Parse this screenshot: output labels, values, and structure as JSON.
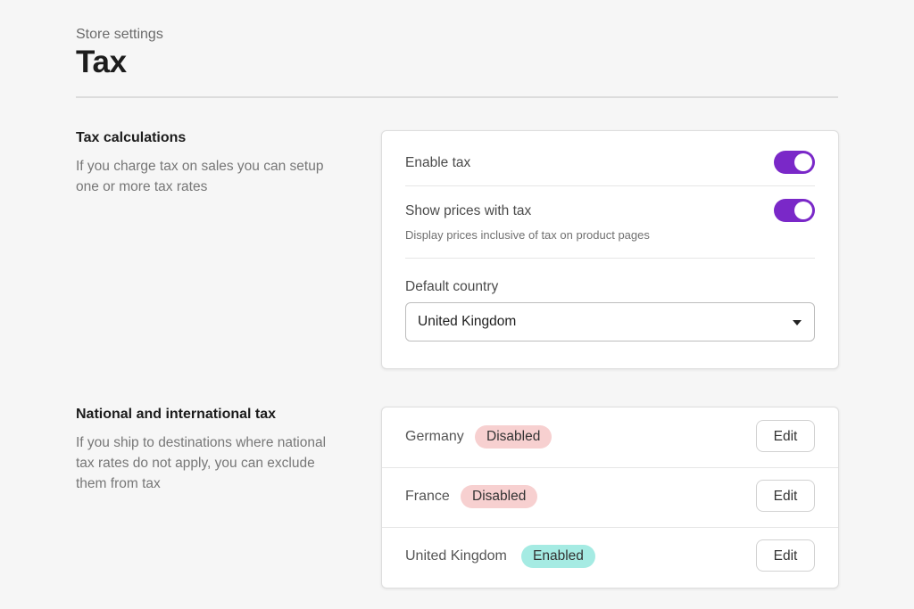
{
  "header": {
    "eyebrow": "Store settings",
    "title": "Tax"
  },
  "tax_calculations": {
    "title": "Tax calculations",
    "description": "If you charge tax on sales you can setup one or more tax rates",
    "enable_tax": {
      "label": "Enable tax",
      "enabled": true
    },
    "show_prices_with_tax": {
      "label": "Show prices with tax",
      "sublabel": "Display prices inclusive of tax on product pages",
      "enabled": true
    },
    "default_country": {
      "label": "Default country",
      "value": "United Kingdom",
      "icon": "caret-down-icon"
    }
  },
  "national_tax": {
    "title": "National and international tax",
    "description": "If you ship to destinations where national tax rates do not apply, you can exclude them from tax",
    "rows": [
      {
        "country": "Germany",
        "status": "Disabled",
        "action": "Edit"
      },
      {
        "country": "France",
        "status": "Disabled",
        "action": "Edit"
      },
      {
        "country": "United Kingdom",
        "status": "Enabled",
        "action": "Edit"
      }
    ]
  },
  "colors": {
    "accent": "#7a28c8",
    "disabled_badge": "#f7d0d0",
    "enabled_badge": "#a5ebe3"
  }
}
